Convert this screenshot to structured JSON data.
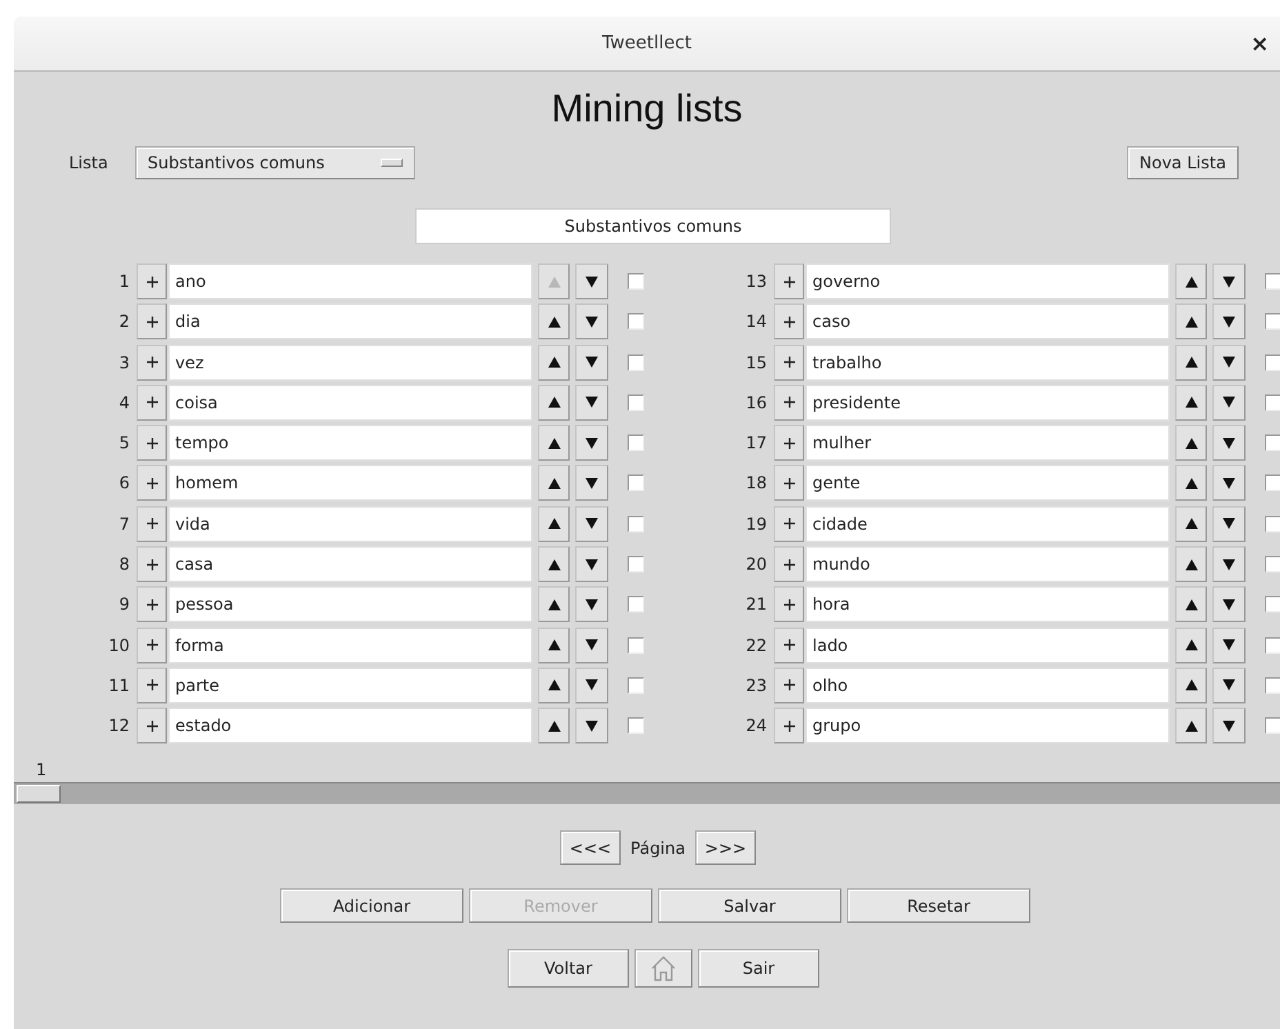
{
  "window": {
    "title": "Tweetllect",
    "close": "×"
  },
  "heading": "Mining lists",
  "list_selector": {
    "label": "Lista",
    "value": "Substantivos comuns"
  },
  "new_list_button": "Nova Lista",
  "list_name": {
    "value": "Substantivos comuns"
  },
  "items": [
    {
      "number": "1",
      "word": "ano",
      "up_disabled": true,
      "checked": false
    },
    {
      "number": "2",
      "word": "dia",
      "up_disabled": false,
      "checked": false
    },
    {
      "number": "3",
      "word": "vez",
      "up_disabled": false,
      "checked": false
    },
    {
      "number": "4",
      "word": "coisa",
      "up_disabled": false,
      "checked": false
    },
    {
      "number": "5",
      "word": "tempo",
      "up_disabled": false,
      "checked": false
    },
    {
      "number": "6",
      "word": "homem",
      "up_disabled": false,
      "checked": false
    },
    {
      "number": "7",
      "word": "vida",
      "up_disabled": false,
      "checked": false
    },
    {
      "number": "8",
      "word": "casa",
      "up_disabled": false,
      "checked": false
    },
    {
      "number": "9",
      "word": "pessoa",
      "up_disabled": false,
      "checked": false
    },
    {
      "number": "10",
      "word": "forma",
      "up_disabled": false,
      "checked": false
    },
    {
      "number": "11",
      "word": "parte",
      "up_disabled": false,
      "checked": false
    },
    {
      "number": "12",
      "word": "estado",
      "up_disabled": false,
      "checked": false
    },
    {
      "number": "13",
      "word": "governo",
      "up_disabled": false,
      "checked": false
    },
    {
      "number": "14",
      "word": "caso",
      "up_disabled": false,
      "checked": false
    },
    {
      "number": "15",
      "word": "trabalho",
      "up_disabled": false,
      "checked": false
    },
    {
      "number": "16",
      "word": "presidente",
      "up_disabled": false,
      "checked": false
    },
    {
      "number": "17",
      "word": "mulher",
      "up_disabled": false,
      "checked": false
    },
    {
      "number": "18",
      "word": "gente",
      "up_disabled": false,
      "checked": false
    },
    {
      "number": "19",
      "word": "cidade",
      "up_disabled": false,
      "checked": false
    },
    {
      "number": "20",
      "word": "mundo",
      "up_disabled": false,
      "checked": false
    },
    {
      "number": "21",
      "word": "hora",
      "up_disabled": false,
      "checked": false
    },
    {
      "number": "22",
      "word": "lado",
      "up_disabled": false,
      "checked": false
    },
    {
      "number": "23",
      "word": "olho",
      "up_disabled": false,
      "checked": false
    },
    {
      "number": "24",
      "word": "grupo",
      "up_disabled": false,
      "checked": false
    }
  ],
  "page_slider": {
    "label": "1",
    "level": 0
  },
  "pagination": {
    "prev": "<<<",
    "label": "Página",
    "next": ">>>"
  },
  "actions": [
    {
      "label": "Adicionar",
      "disabled": false
    },
    {
      "label": "Remover",
      "disabled": true
    },
    {
      "label": "Salvar",
      "disabled": false
    },
    {
      "label": "Resetar",
      "disabled": false
    }
  ],
  "bottom": {
    "back": "Voltar",
    "exit": "Sair"
  }
}
